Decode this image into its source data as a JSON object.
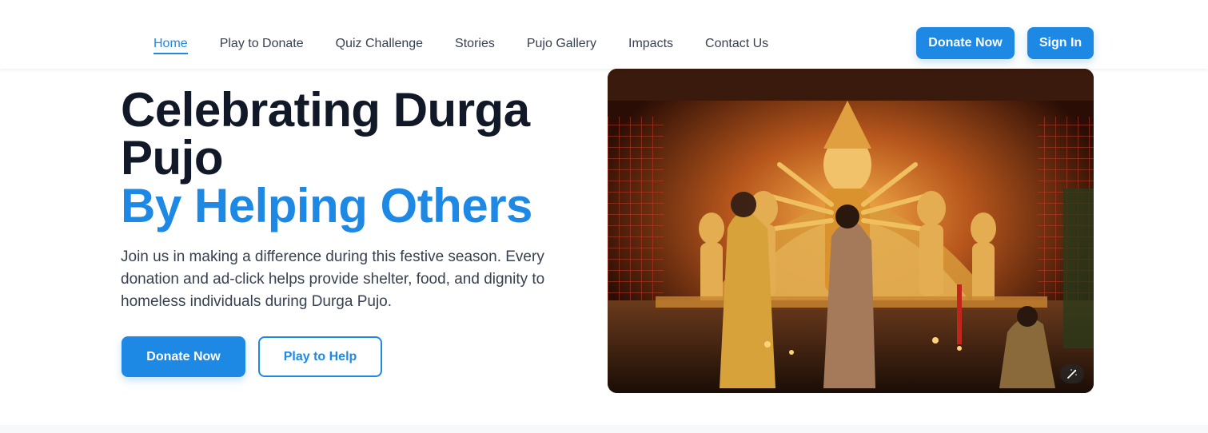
{
  "nav": {
    "links": [
      {
        "label": "Home"
      },
      {
        "label": "Play to Donate"
      },
      {
        "label": "Quiz Challenge"
      },
      {
        "label": "Stories"
      },
      {
        "label": "Pujo Gallery"
      },
      {
        "label": "Impacts"
      },
      {
        "label": "Contact Us"
      }
    ],
    "donate_label": "Donate Now",
    "signin_label": "Sign In"
  },
  "hero": {
    "title_line1": "Celebrating Durga Pujo",
    "title_line2": "By Helping Others",
    "description": "Join us in making a difference during this festive season. Every donation and ad-click helps provide shelter, food, and dignity to homeless individuals during Durga Pujo.",
    "donate_label": "Donate Now",
    "play_label": "Play to Help",
    "image_icon": "magic-wand-icon"
  },
  "colors": {
    "accent": "#1e88e5",
    "heading": "#111827",
    "body_text": "#374151"
  }
}
